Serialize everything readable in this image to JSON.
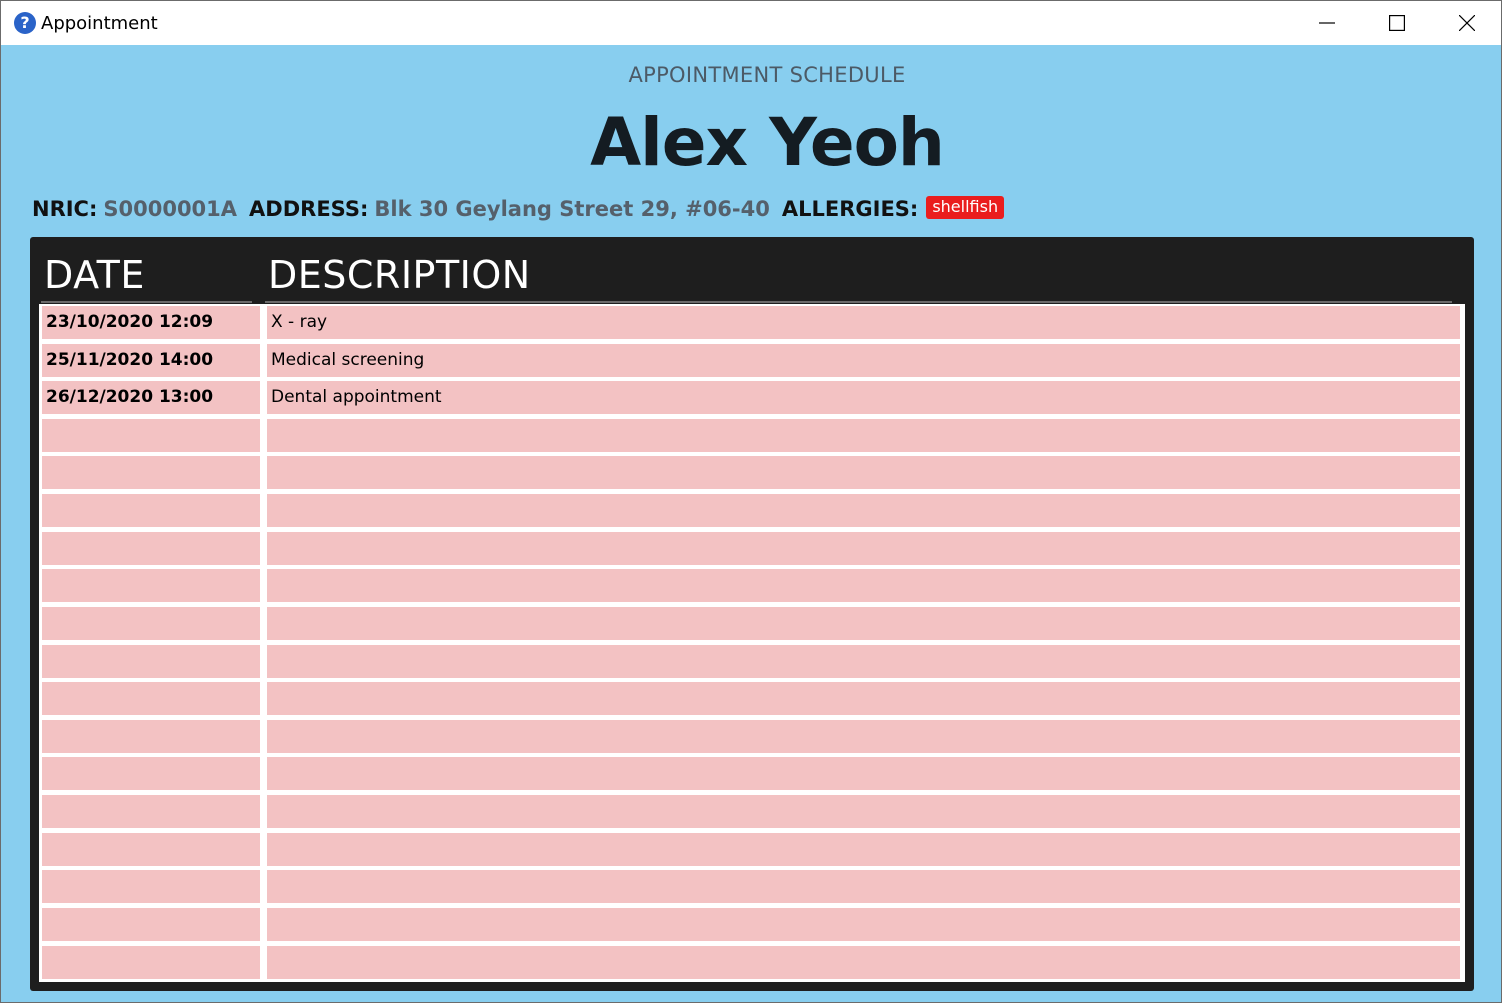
{
  "window": {
    "title": "Appointment",
    "app_icon_glyph": "?"
  },
  "header": {
    "subtitle": "APPOINTMENT SCHEDULE",
    "patient_name": "Alex Yeoh"
  },
  "info": {
    "nric_label": "NRIC:",
    "nric_value": "S0000001A",
    "address_label": "ADDRESS:",
    "address_value": "Blk 30 Geylang Street 29, #06-40",
    "allergies_label": "ALLERGIES:",
    "allergies": [
      "shellfish"
    ]
  },
  "table": {
    "columns": [
      "DATE",
      "DESCRIPTION"
    ],
    "rows": [
      {
        "date": "23/10/2020 12:09",
        "description": "X - ray"
      },
      {
        "date": "25/11/2020 14:00",
        "description": "Medical screening"
      },
      {
        "date": "26/12/2020 13:00",
        "description": "Dental appointment"
      },
      {
        "date": "",
        "description": ""
      },
      {
        "date": "",
        "description": ""
      },
      {
        "date": "",
        "description": ""
      },
      {
        "date": "",
        "description": ""
      },
      {
        "date": "",
        "description": ""
      },
      {
        "date": "",
        "description": ""
      },
      {
        "date": "",
        "description": ""
      },
      {
        "date": "",
        "description": ""
      },
      {
        "date": "",
        "description": ""
      },
      {
        "date": "",
        "description": ""
      },
      {
        "date": "",
        "description": ""
      },
      {
        "date": "",
        "description": ""
      },
      {
        "date": "",
        "description": ""
      },
      {
        "date": "",
        "description": ""
      },
      {
        "date": "",
        "description": ""
      }
    ]
  },
  "colors": {
    "window_background": "#88ceef",
    "table_background": "#1e1e1e",
    "row_background": "#f3c2c3",
    "allergy_tag": "#ea1d1d"
  },
  "icons": {
    "app": "help-question-icon",
    "minimize": "minimize-icon",
    "maximize": "maximize-icon",
    "close": "close-icon"
  }
}
